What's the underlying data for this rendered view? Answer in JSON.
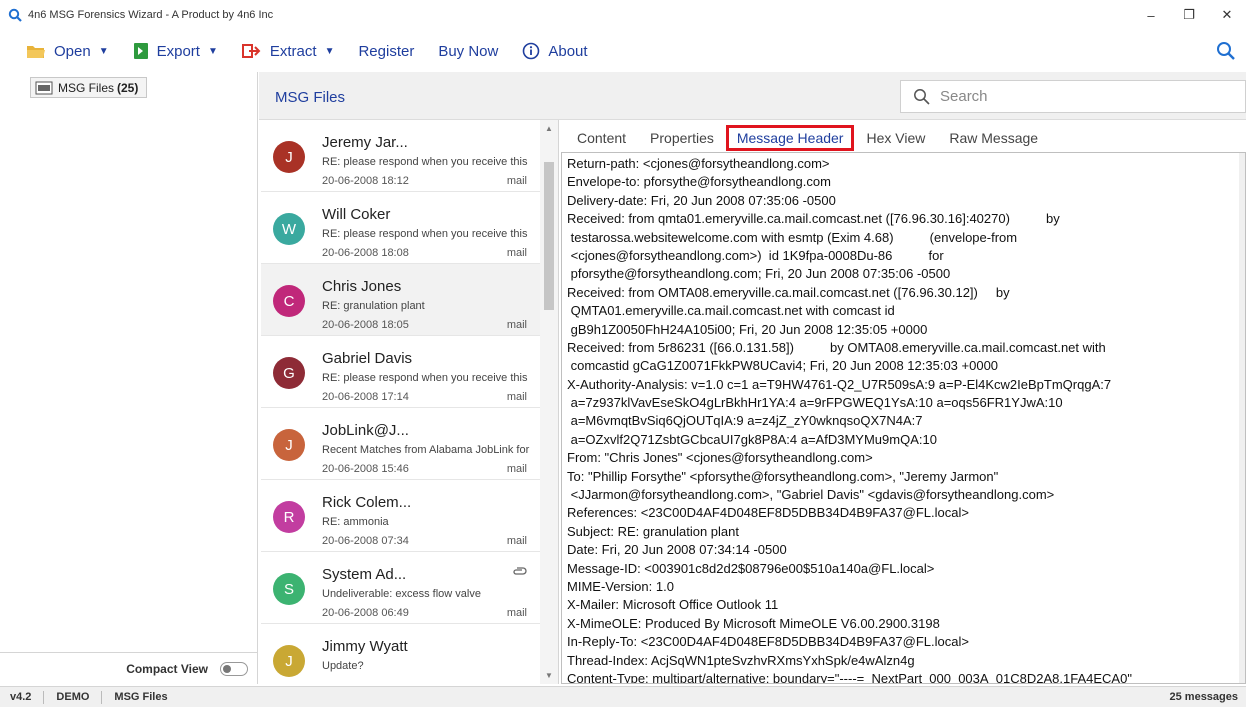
{
  "window": {
    "title": "4n6 MSG Forensics Wizard - A Product by 4n6 Inc",
    "controls": {
      "minimize": "–",
      "maximize": "❐",
      "close": "✕"
    }
  },
  "menu": {
    "open": "Open",
    "export": "Export",
    "extract": "Extract",
    "register": "Register",
    "buy_now": "Buy Now",
    "about": "About"
  },
  "sidebar": {
    "tree_label": "MSG Files",
    "tree_count": "(25)",
    "compact_view": "Compact View",
    "compact_on": false
  },
  "list_header": {
    "title": "MSG Files",
    "search_placeholder": "Search"
  },
  "emails": [
    {
      "initial": "J",
      "sender": "Jeremy Jar...",
      "subject": "RE: please respond when you receive this",
      "date": "20-06-2008 18:12",
      "type": "mail",
      "color": "#a93226",
      "attachment": false,
      "selected": false
    },
    {
      "initial": "W",
      "sender": "Will Coker",
      "subject": "RE: please respond when you receive this",
      "date": "20-06-2008 18:08",
      "type": "mail",
      "color": "#3aa99f",
      "attachment": false,
      "selected": false
    },
    {
      "initial": "C",
      "sender": "Chris Jones",
      "subject": "RE: granulation plant",
      "date": "20-06-2008 18:05",
      "type": "mail",
      "color": "#c0287a",
      "attachment": false,
      "selected": true
    },
    {
      "initial": "G",
      "sender": "Gabriel Davis",
      "subject": "RE: please respond when you receive this",
      "date": "20-06-2008 17:14",
      "type": "mail",
      "color": "#8e2b36",
      "attachment": false,
      "selected": false
    },
    {
      "initial": "J",
      "sender": "JobLink@J...",
      "subject": "Recent Matches from Alabama JobLink for",
      "date": "20-06-2008 15:46",
      "type": "mail",
      "color": "#c8643c",
      "attachment": false,
      "selected": false
    },
    {
      "initial": "R",
      "sender": "Rick Colem...",
      "subject": "RE: ammonia",
      "date": "20-06-2008 07:34",
      "type": "mail",
      "color": "#c23da0",
      "attachment": false,
      "selected": false
    },
    {
      "initial": "S",
      "sender": "System Ad...",
      "subject": "Undeliverable: excess flow valve",
      "date": "20-06-2008 06:49",
      "type": "mail",
      "color": "#3cb371",
      "attachment": true,
      "selected": false
    },
    {
      "initial": "J",
      "sender": "Jimmy Wyatt",
      "subject": "Update?",
      "date": "",
      "type": "",
      "color": "#c9a834",
      "attachment": false,
      "selected": false
    }
  ],
  "tabs": [
    {
      "label": "Content",
      "active": false
    },
    {
      "label": "Properties",
      "active": false
    },
    {
      "label": "Message Header",
      "active": true
    },
    {
      "label": "Hex View",
      "active": false
    },
    {
      "label": "Raw Message",
      "active": false
    }
  ],
  "header_lines": [
    "Return-path: <cjones@forsytheandlong.com>",
    "Envelope-to: pforsythe@forsytheandlong.com",
    "Delivery-date: Fri, 20 Jun 2008 07:35:06 -0500",
    "Received: from qmta01.emeryville.ca.mail.comcast.net ([76.96.30.16]:40270)          by",
    " testarossa.websitewelcome.com with esmtp (Exim 4.68)          (envelope-from",
    " <cjones@forsytheandlong.com>)  id 1K9fpa-0008Du-86          for",
    " pforsythe@forsytheandlong.com; Fri, 20 Jun 2008 07:35:06 -0500",
    "Received: from OMTA08.emeryville.ca.mail.comcast.net ([76.96.30.12])     by",
    " QMTA01.emeryville.ca.mail.comcast.net with comcast id",
    " gB9h1Z0050FhH24A105i00; Fri, 20 Jun 2008 12:35:05 +0000",
    "Received: from 5r86231 ([66.0.131.58])          by OMTA08.emeryville.ca.mail.comcast.net with",
    " comcastid gCaG1Z0071FkkPW8UCavi4; Fri, 20 Jun 2008 12:35:03 +0000",
    "X-Authority-Analysis: v=1.0 c=1 a=T9HW4761-Q2_U7R509sA:9 a=P-El4Kcw2IeBpTmQrqgA:7",
    " a=7z937klVavEseSkO4gLrBkhHr1YA:4 a=9rFPGWEQ1YsA:10 a=oqs56FR1YJwA:10",
    " a=M6vmqtBvSiq6QjOUTqIA:9 a=z4jZ_zY0wknqsoQX7N4A:7",
    " a=OZxvlf2Q71ZsbtGCbcaUI7gk8P8A:4 a=AfD3MYMu9mQA:10",
    "From: \"Chris Jones\" <cjones@forsytheandlong.com>",
    "To: \"Phillip Forsythe\" <pforsythe@forsytheandlong.com>, \"Jeremy Jarmon\"",
    " <JJarmon@forsytheandlong.com>, \"Gabriel Davis\" <gdavis@forsytheandlong.com>",
    "References: <23C00D4AF4D048EF8D5DBB34D4B9FA37@FL.local>",
    "Subject: RE: granulation plant",
    "Date: Fri, 20 Jun 2008 07:34:14 -0500",
    "Message-ID: <003901c8d2d2$08796e00$510a140a@FL.local>",
    "MIME-Version: 1.0",
    "X-Mailer: Microsoft Office Outlook 11",
    "X-MimeOLE: Produced By Microsoft MimeOLE V6.00.2900.3198",
    "In-Reply-To: <23C00D4AF4D048EF8D5DBB34D4B9FA37@FL.local>",
    "Thread-Index: AcjSqWN1pteSvzhvRXmsYxhSpk/e4wAlzn4g",
    "Content-Type: multipart/alternative; boundary=\"----=_NextPart_000_003A_01C8D2A8.1FA4ECA0\""
  ],
  "status": {
    "version": "v4.2",
    "mode": "DEMO",
    "section": "MSG Files",
    "message_count": "25 messages"
  },
  "colors": {
    "accent_blue": "#1f3e9e",
    "highlight_red": "#e0141e",
    "folder_yellow": "#e8b33a",
    "export_green": "#2e9a3e",
    "extract_red": "#d9342b"
  }
}
